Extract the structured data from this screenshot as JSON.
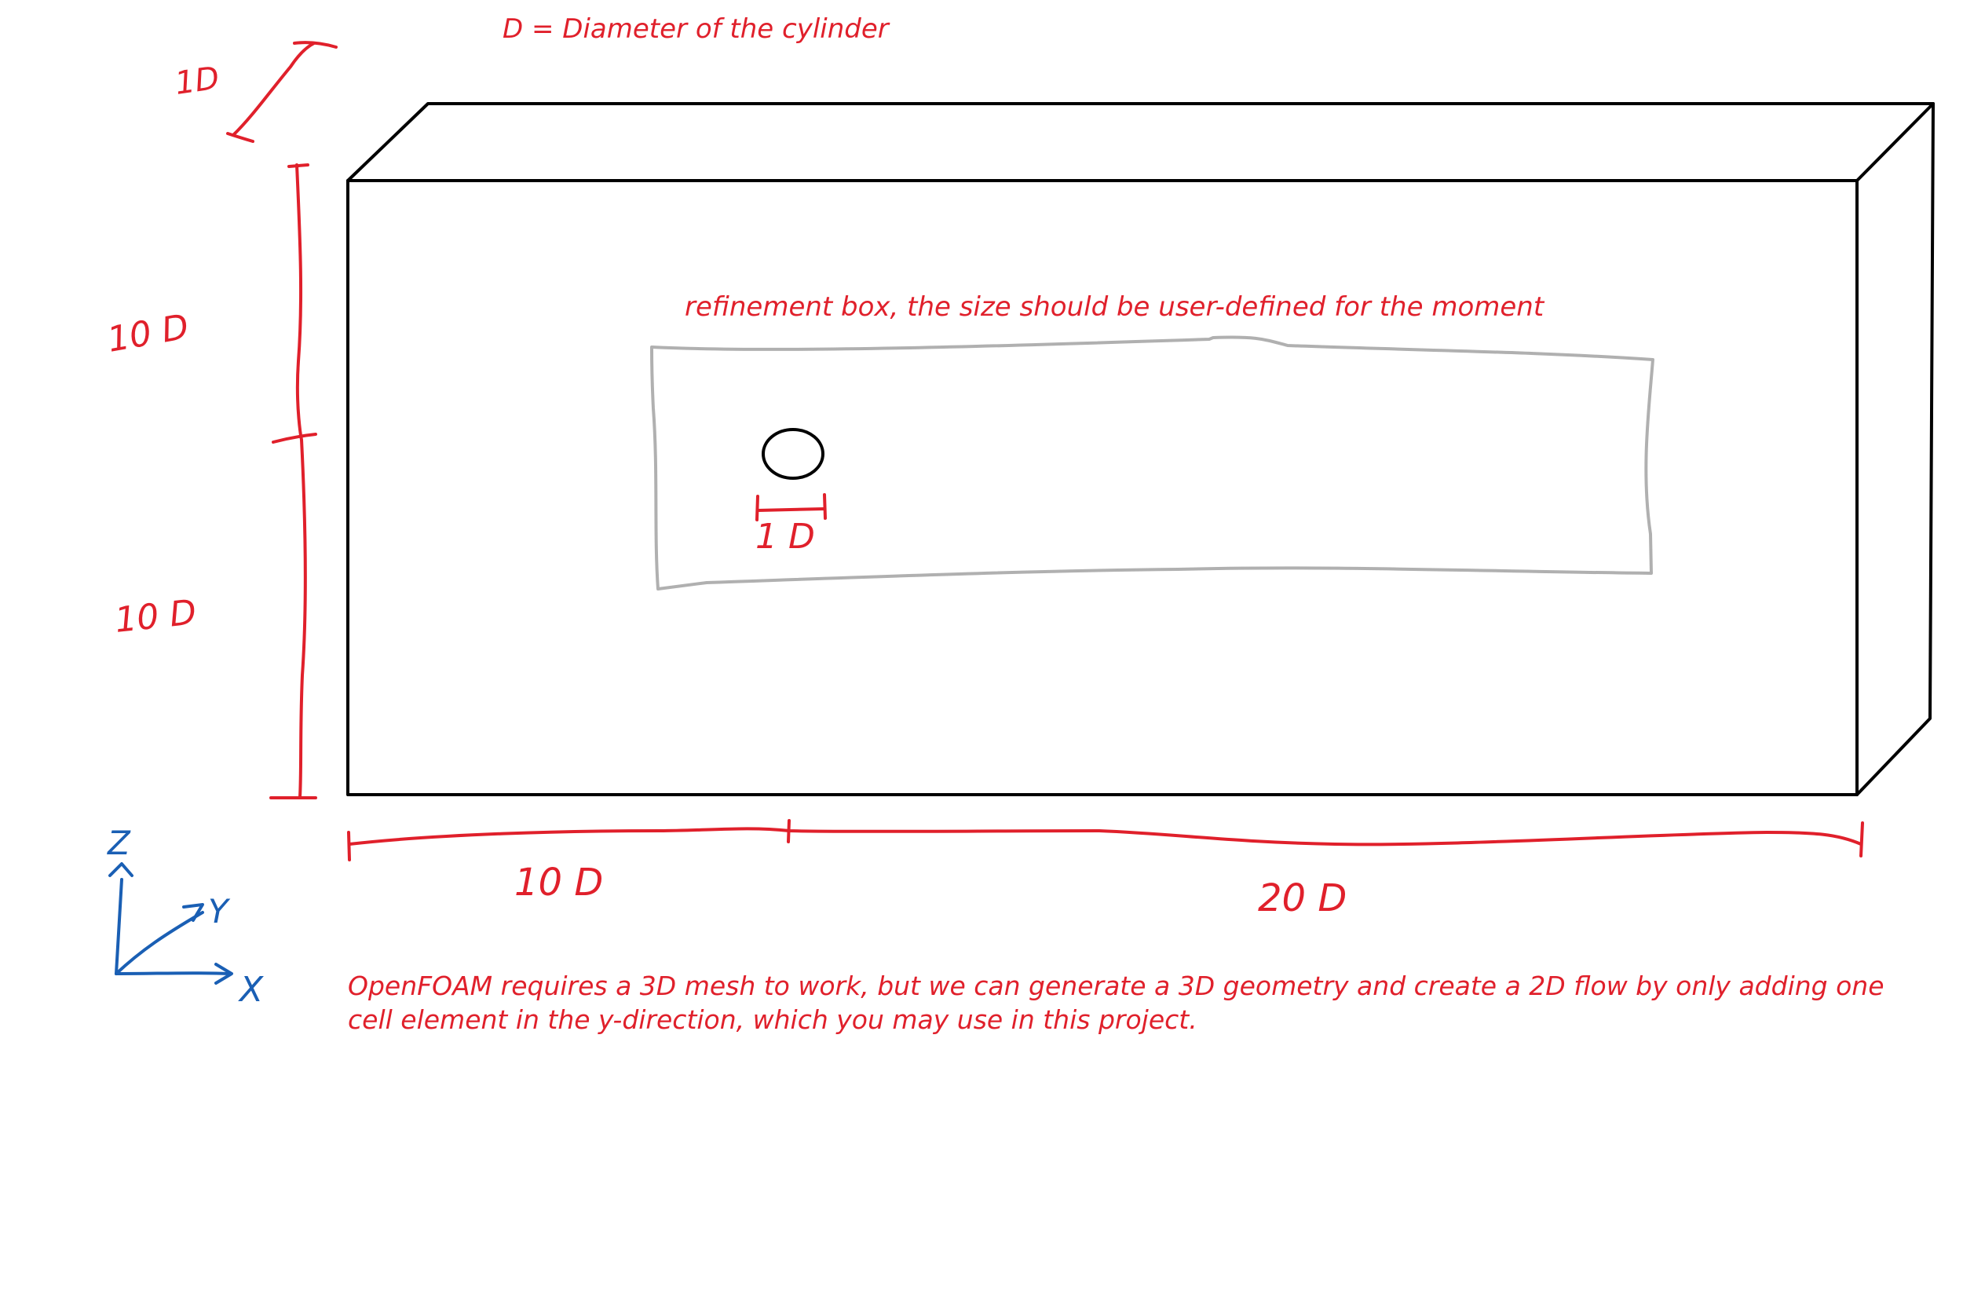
{
  "notes": {
    "definition": "D = Diameter of the cylinder",
    "refinement": "refinement box, the size should be user-defined for the moment",
    "openfoam_line1": "OpenFOAM requires a 3D mesh to work, but we can generate a 3D geometry and create a 2D flow by only adding one",
    "openfoam_line2": "cell element in the y-direction, which you may use in this project."
  },
  "dimensions": {
    "depth": "1D",
    "upper_height": "10 D",
    "lower_height": "10 D",
    "upstream_length": "10 D",
    "downstream_length": "20 D",
    "cylinder_diameter": "1 D"
  },
  "axes": {
    "z": "Z",
    "y": "Y",
    "x": "X"
  },
  "colors": {
    "annotation": "#e0202b",
    "axes": "#1a5fb4",
    "geometry": "#000000",
    "refinement_box": "#b0b0b0"
  }
}
